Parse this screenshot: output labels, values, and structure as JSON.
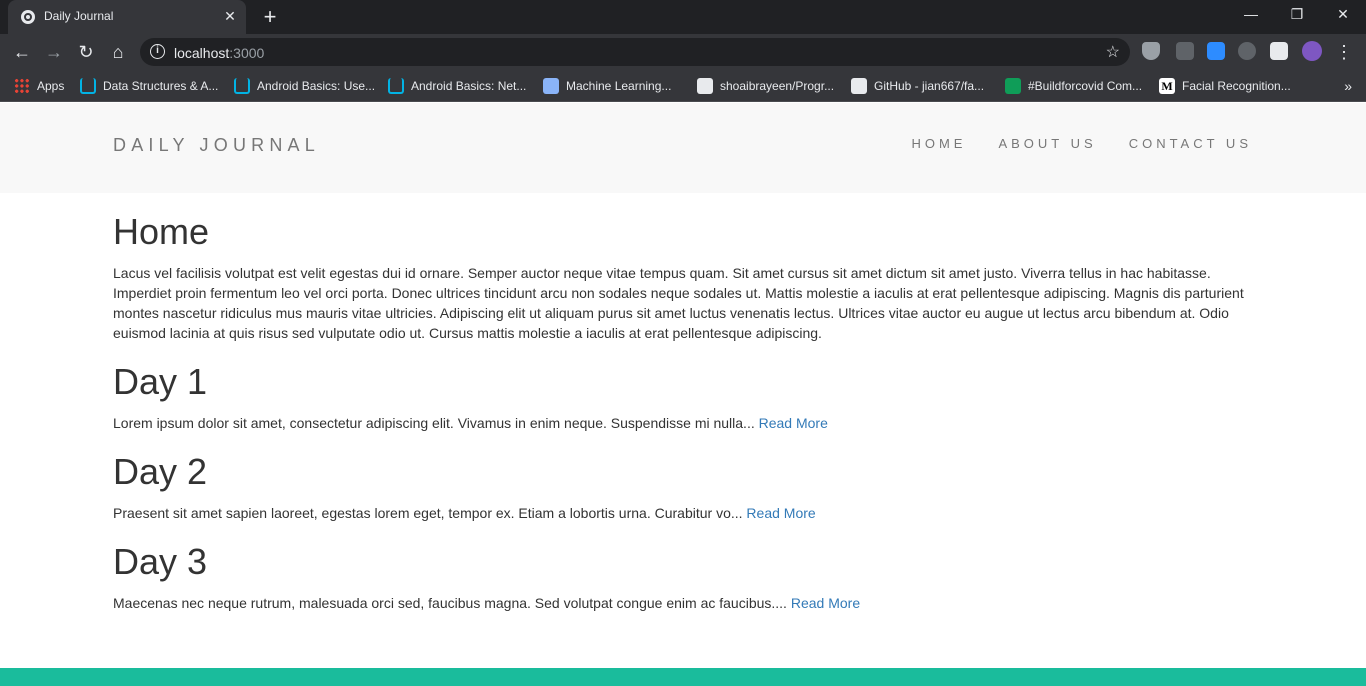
{
  "browser": {
    "tab_title": "Daily Journal",
    "new_tab": "+",
    "close_tab": "✕",
    "url_host": "localhost",
    "url_port": ":3000",
    "window_controls": {
      "minimize": "—",
      "restore": "❐",
      "close": "✕"
    }
  },
  "bookmarks": [
    {
      "label": "Apps",
      "icon": "apps-icon"
    },
    {
      "label": "Data Structures & A...",
      "icon": "udacity-icon"
    },
    {
      "label": "Android Basics: Use...",
      "icon": "udacity-icon"
    },
    {
      "label": "Android Basics: Net...",
      "icon": "udacity-icon"
    },
    {
      "label": "Machine Learning...",
      "icon": "ml-icon"
    },
    {
      "label": "shoaibrayeen/Progr...",
      "icon": "github-icon"
    },
    {
      "label": "GitHub - jian667/fa...",
      "icon": "github-icon"
    },
    {
      "label": "#Buildforcovid Com...",
      "icon": "buildforcovid-icon"
    },
    {
      "label": "Facial Recognition...",
      "icon": "medium-icon"
    }
  ],
  "site": {
    "brand": "DAILY JOURNAL",
    "nav": {
      "home": "HOME",
      "about": "ABOUT US",
      "contact": "CONTACT US"
    }
  },
  "home": {
    "title": "Home",
    "body": "Lacus vel facilisis volutpat est velit egestas dui id ornare. Semper auctor neque vitae tempus quam. Sit amet cursus sit amet dictum sit amet justo. Viverra tellus in hac habitasse. Imperdiet proin fermentum leo vel orci porta. Donec ultrices tincidunt arcu non sodales neque sodales ut. Mattis molestie a iaculis at erat pellentesque adipiscing. Magnis dis parturient montes nascetur ridiculus mus mauris vitae ultricies. Adipiscing elit ut aliquam purus sit amet luctus venenatis lectus. Ultrices vitae auctor eu augue ut lectus arcu bibendum at. Odio euismod lacinia at quis risus sed vulputate odio ut. Cursus mattis molestie a iaculis at erat pellentesque adipiscing."
  },
  "posts": [
    {
      "title": "Day 1",
      "excerpt": "Lorem ipsum dolor sit amet, consectetur adipiscing elit. Vivamus in enim neque. Suspendisse mi nulla...",
      "link": "Read More"
    },
    {
      "title": "Day 2",
      "excerpt": "Praesent sit amet sapien laoreet, egestas lorem eget, tempor ex. Etiam a lobortis urna. Curabitur vo...",
      "link": "Read More"
    },
    {
      "title": "Day 3",
      "excerpt": "Maecenas nec neque rutrum, malesuada orci sed, faucibus magna. Sed volutpat congue enim ac faucibus....",
      "link": "Read More"
    }
  ],
  "colors": {
    "footer": "#1abc9c",
    "link": "#337ab7",
    "header_bg": "#f8f8f8"
  }
}
